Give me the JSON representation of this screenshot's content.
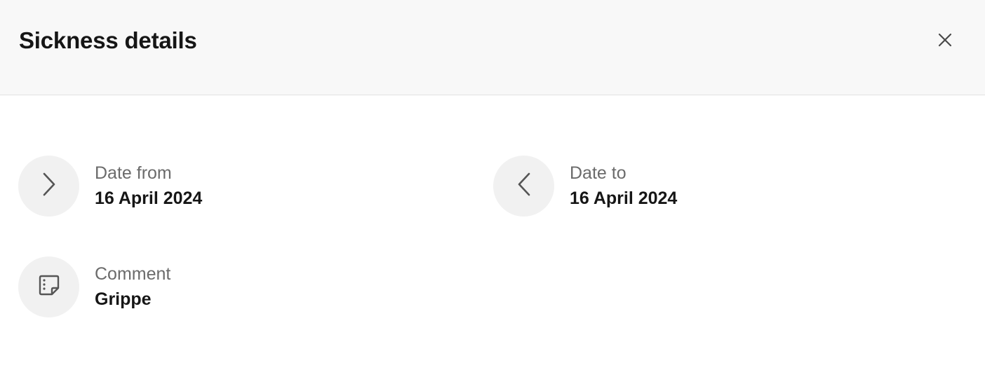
{
  "header": {
    "title": "Sickness details",
    "close_icon": "close-icon"
  },
  "details": {
    "date_from": {
      "icon": "chevron-right-icon",
      "label": "Date from",
      "value": "16 April 2024"
    },
    "date_to": {
      "icon": "chevron-left-icon",
      "label": "Date to",
      "value": "16 April 2024"
    },
    "comment": {
      "icon": "note-icon",
      "label": "Comment",
      "value": "Grippe"
    }
  },
  "colors": {
    "header_bg": "#f8f8f8",
    "icon_circle_bg": "#f1f1f1",
    "label_text": "#6b6b6b",
    "value_text": "#161616"
  }
}
